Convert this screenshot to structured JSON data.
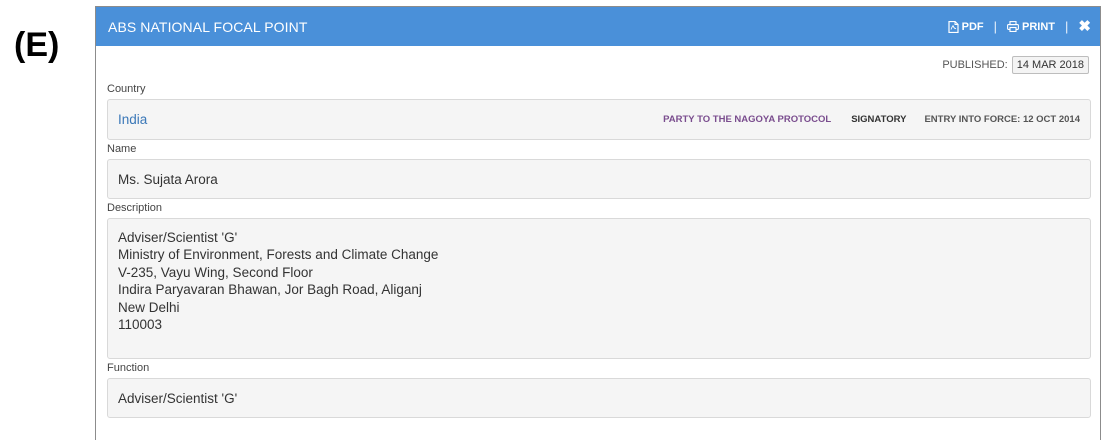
{
  "panel_label": "(E)",
  "header": {
    "title": "ABS NATIONAL FOCAL POINT",
    "pdf_label": "PDF",
    "print_label": "PRINT",
    "separator": "|"
  },
  "published": {
    "label": "PUBLISHED:",
    "date": "14 MAR 2018"
  },
  "fields": {
    "country": {
      "label": "Country",
      "value": "India",
      "party_tag": "PARTY TO THE NAGOYA PROTOCOL",
      "signatory_tag": "SIGNATORY",
      "entry_into_force": "ENTRY INTO FORCE: 12 OCT 2014"
    },
    "name": {
      "label": "Name",
      "value": "Ms. Sujata Arora"
    },
    "description": {
      "label": "Description",
      "lines": [
        "Adviser/Scientist 'G'",
        "Ministry of Environment, Forests and Climate Change",
        "V-235, Vayu Wing, Second Floor",
        "Indira Paryavaran Bhawan, Jor Bagh Road, Aliganj",
        "New Delhi",
        "110003"
      ]
    },
    "function": {
      "label": "Function",
      "value": "Adviser/Scientist 'G'"
    }
  },
  "icons": {
    "pdf": "pdf-icon",
    "print": "print-icon",
    "close": "close-icon"
  },
  "colors": {
    "titlebar": "#4a90d9",
    "country_link": "#3b78b8",
    "party_tag": "#7a4d8e"
  }
}
